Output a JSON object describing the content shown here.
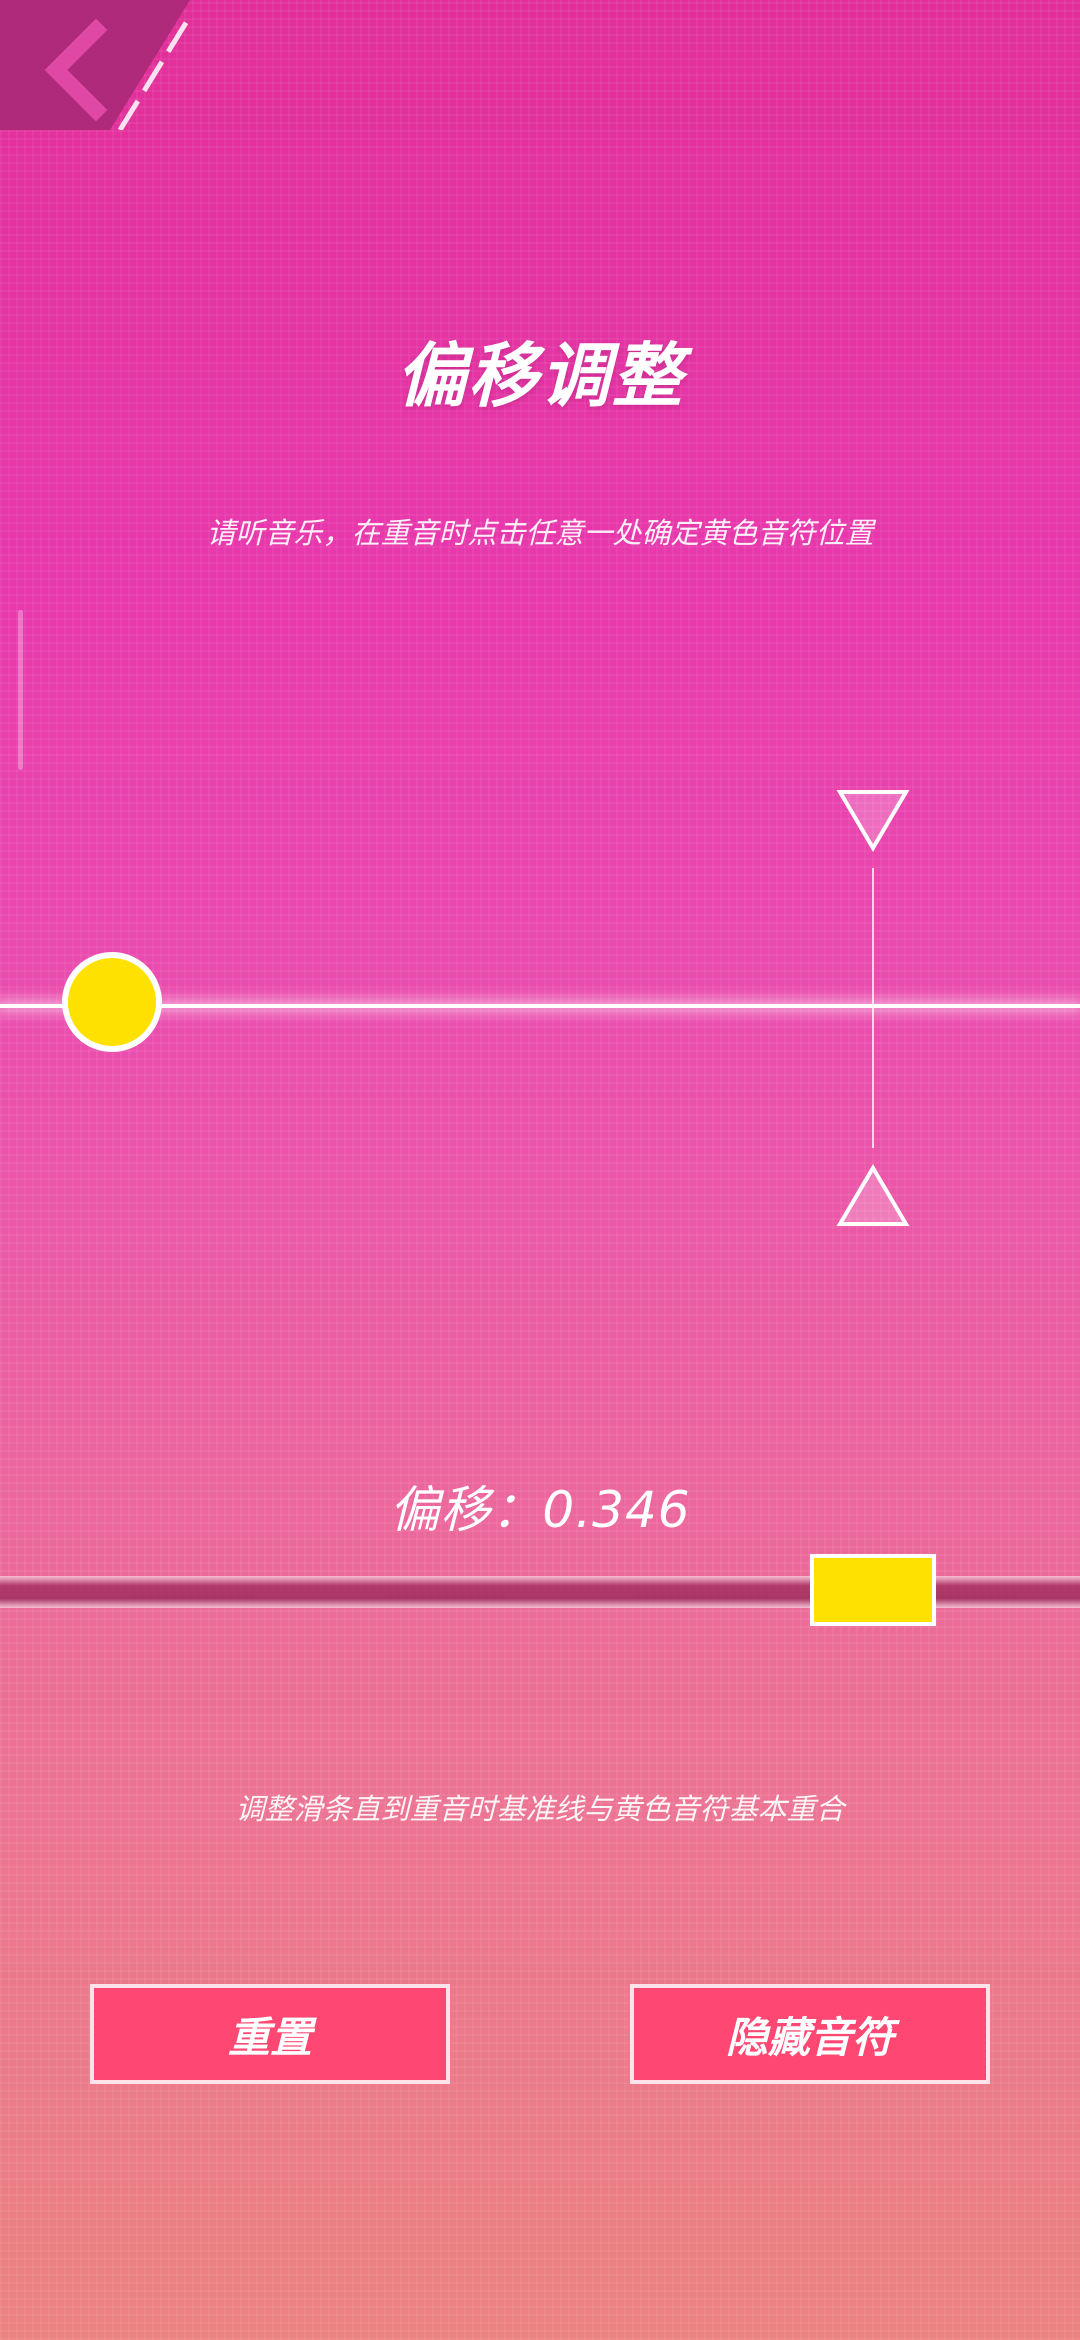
{
  "header": {
    "back_icon": "chevron-left-icon"
  },
  "title": "偏移调整",
  "instruction": "请听音乐，在重音时点击任意一处确定黄色音符位置",
  "offset": {
    "label": "偏移：",
    "value": "0.346"
  },
  "hint": "调整滑条直到重音时基准线与黄色音符基本重合",
  "buttons": {
    "reset_label": "重置",
    "hide_notes_label": "隐藏音符"
  },
  "colors": {
    "accent_yellow": "#ffe100",
    "button_bg": "#ff4773"
  }
}
